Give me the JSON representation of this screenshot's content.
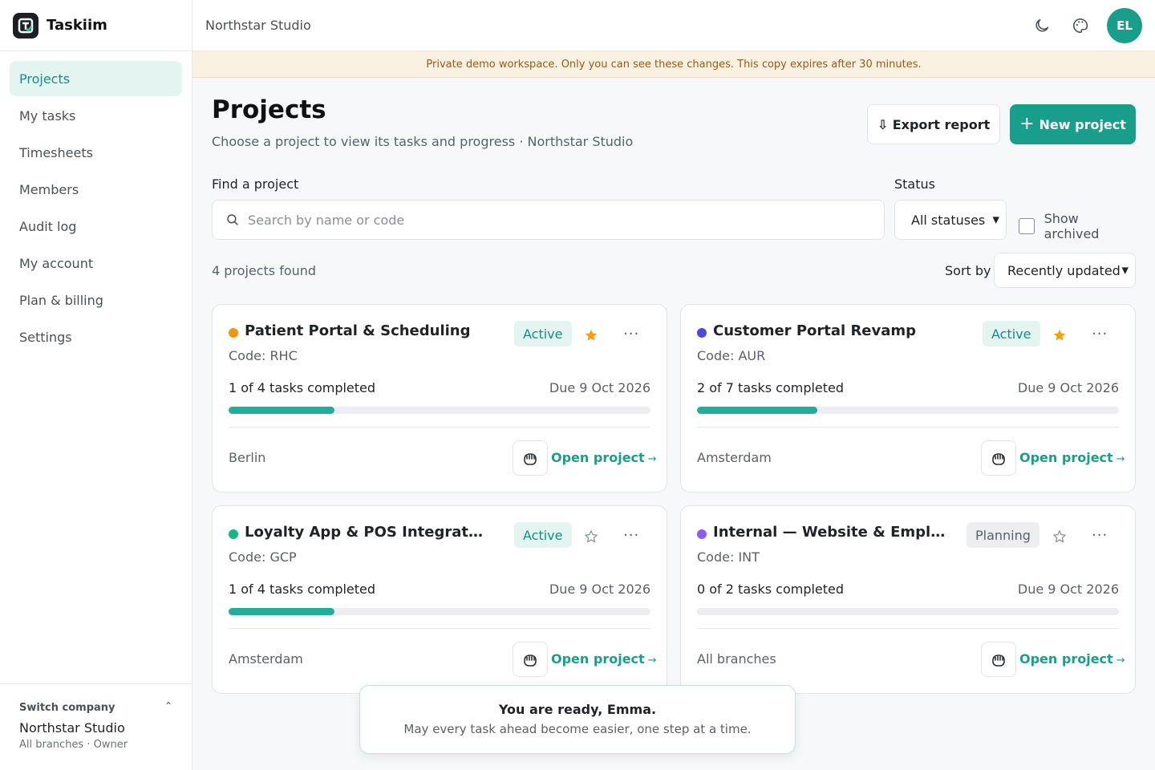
{
  "app": {
    "name": "Taskiim"
  },
  "sidebar": {
    "items": [
      {
        "label": "Projects",
        "active": true
      },
      {
        "label": "My tasks"
      },
      {
        "label": "Timesheets"
      },
      {
        "label": "Members"
      },
      {
        "label": "Audit log"
      },
      {
        "label": "My account"
      },
      {
        "label": "Plan & billing"
      },
      {
        "label": "Settings"
      }
    ],
    "company": {
      "label": "Switch company",
      "name": "Northstar Studio",
      "sub": "All branches · Owner"
    }
  },
  "topbar": {
    "title": "Northstar Studio",
    "icons": [
      "moon-icon",
      "palette-icon"
    ],
    "avatar": "EL"
  },
  "banner": {
    "text": "Private demo workspace.  Only you can see these changes. This copy expires after 30 minutes."
  },
  "header": {
    "title": "Projects",
    "subtitle": "Choose a project to view its tasks and progress · Northstar Studio",
    "export_label": "⇩ Export report",
    "new_label": "New project"
  },
  "filters": {
    "find_label": "Find a project",
    "search_placeholder": "Search by name or code",
    "status_label": "Status",
    "status_value": "All statuses",
    "archived_label": "Show archived",
    "archived_checked": false
  },
  "results": {
    "count": "4 projects found",
    "sort_label": "Sort by",
    "sort_value": "Recently updated"
  },
  "projects": [
    {
      "name": "Patient Portal & Scheduling",
      "dot_color": "#f5950b",
      "status": "Active",
      "starred": true,
      "code": "Code: RHC",
      "tasks": "1 of 4 tasks completed",
      "progress": 0.25,
      "due": "Due 9 Oct 2026",
      "location": "Berlin",
      "open_label": "Open project",
      "arrow": "→"
    },
    {
      "name": "Customer Portal Revamp",
      "dot_color": "#4f46e5",
      "status": "Active",
      "starred": true,
      "code": "Code: AUR",
      "tasks": "2 of 7 tasks completed",
      "progress": 0.2857,
      "due": "Due 9 Oct 2026",
      "location": "Amsterdam",
      "open_label": "Open project",
      "arrow": "→"
    },
    {
      "name": "Loyalty App & POS Integration",
      "dot_color": "#10b981",
      "status": "Active",
      "starred": false,
      "code": "Code: GCP",
      "tasks": "1 of 4 tasks completed",
      "progress": 0.25,
      "due": "Due 9 Oct 2026",
      "location": "Amsterdam",
      "open_label": "Open project",
      "arrow": "→"
    },
    {
      "name": "Internal — Website & Employer ...",
      "dot_color": "#8b5cf6",
      "status": "Planning",
      "starred": false,
      "code": "Code: INT",
      "tasks": "0 of 2 tasks completed",
      "progress": 0,
      "due": "Due 9 Oct 2026",
      "location": "All branches",
      "open_label": "Open project",
      "arrow": "→"
    }
  ],
  "toast": {
    "title": "You are ready, Emma.",
    "message": "May every task ahead become easier, one step at a time."
  },
  "colors": {
    "accent": "#1a9e8c",
    "banner_bg": "#fbf1e2",
    "star_filled": "#f5a00b"
  }
}
